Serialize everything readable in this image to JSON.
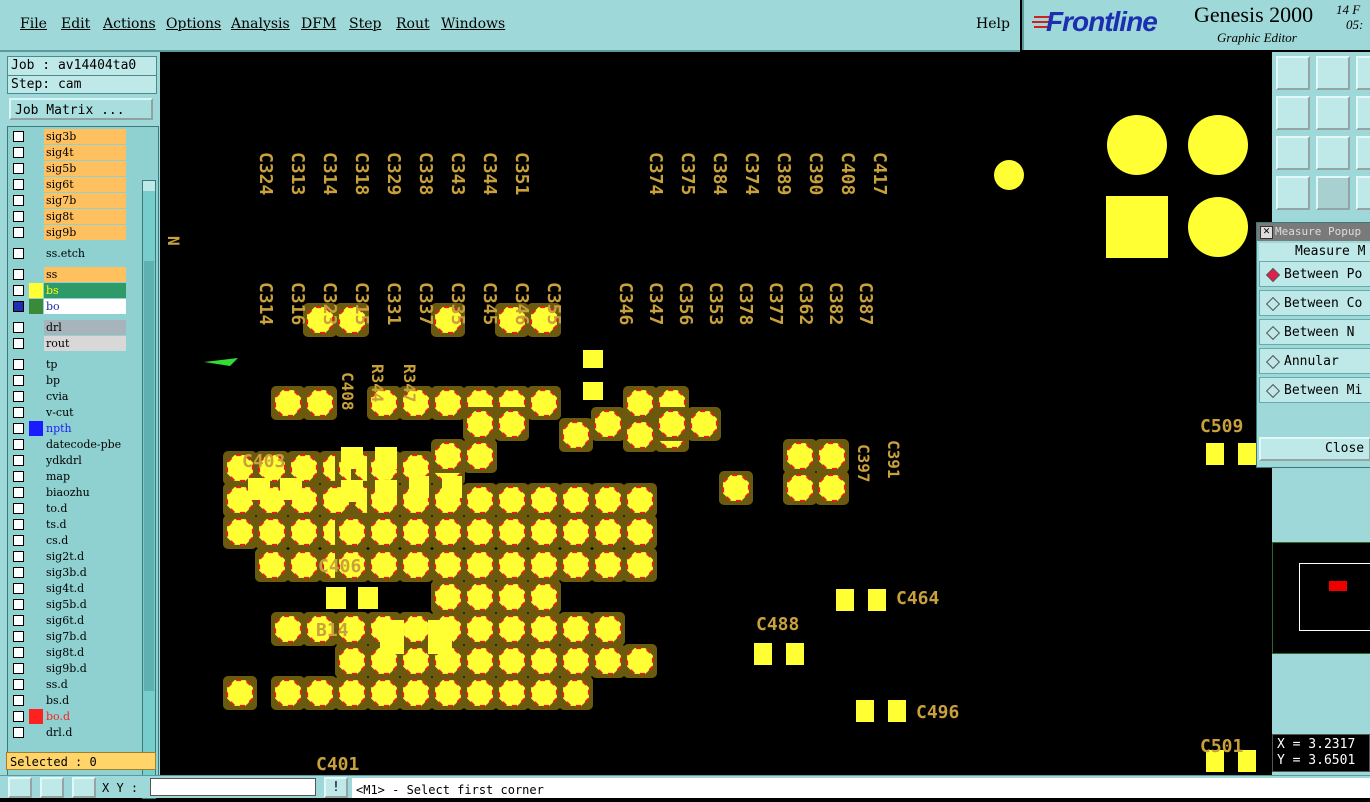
{
  "menu": {
    "items": [
      "File",
      "Edit",
      "Actions",
      "Options",
      "Analysis",
      "DFM",
      "Step",
      "Rout",
      "Windows"
    ],
    "help": "Help"
  },
  "brand": {
    "logo": "Frontline",
    "product": "Genesis 2000",
    "subtitle": "Graphic Editor",
    "date_fragment": "14 F",
    "time_fragment": "05:"
  },
  "job": {
    "job_line": "Job : av14404ta0",
    "step_line": "Step: cam",
    "matrix_button": "Job Matrix ..."
  },
  "layers": [
    {
      "name": "sig3b",
      "bg": "#ffc060"
    },
    {
      "name": "sig4t",
      "bg": "#ffc060"
    },
    {
      "name": "sig5b",
      "bg": "#ffc060"
    },
    {
      "name": "sig6t",
      "bg": "#ffc060"
    },
    {
      "name": "sig7b",
      "bg": "#ffc060"
    },
    {
      "name": "sig8t",
      "bg": "#ffc060"
    },
    {
      "name": "sig9b",
      "bg": "#ffc060"
    },
    {
      "name": "ss.etch",
      "bg": "#8fd0d0"
    },
    {
      "name": "ss",
      "bg": "#ffc060"
    },
    {
      "name": "bs",
      "bg": "#2e9a6a",
      "color": "#ffff00"
    },
    {
      "name": "bo",
      "bg": "#ffffff",
      "color": "#1c2a9a"
    },
    {
      "name": "drl",
      "bg": "#a8b4bc"
    },
    {
      "name": "rout",
      "bg": "#d8d8d8"
    },
    {
      "name": "tp",
      "bg": "#8fd0d0"
    },
    {
      "name": "bp",
      "bg": "#8fd0d0"
    },
    {
      "name": "cvia",
      "bg": "#8fd0d0"
    },
    {
      "name": "v-cut",
      "bg": "#8fd0d0"
    },
    {
      "name": "npth",
      "bg": "#8fd0d0",
      "color": "#1b1bff"
    },
    {
      "name": "datecode-pbe",
      "bg": "#8fd0d0"
    },
    {
      "name": "ydkdrl",
      "bg": "#8fd0d0"
    },
    {
      "name": "map",
      "bg": "#8fd0d0"
    },
    {
      "name": "biaozhu",
      "bg": "#8fd0d0"
    },
    {
      "name": "to.d",
      "bg": "#8fd0d0"
    },
    {
      "name": "ts.d",
      "bg": "#8fd0d0"
    },
    {
      "name": "cs.d",
      "bg": "#8fd0d0"
    },
    {
      "name": "sig2t.d",
      "bg": "#8fd0d0"
    },
    {
      "name": "sig3b.d",
      "bg": "#8fd0d0"
    },
    {
      "name": "sig4t.d",
      "bg": "#8fd0d0"
    },
    {
      "name": "sig5b.d",
      "bg": "#8fd0d0"
    },
    {
      "name": "sig6t.d",
      "bg": "#8fd0d0"
    },
    {
      "name": "sig7b.d",
      "bg": "#8fd0d0"
    },
    {
      "name": "sig8t.d",
      "bg": "#8fd0d0"
    },
    {
      "name": "sig9b.d",
      "bg": "#8fd0d0"
    },
    {
      "name": "ss.d",
      "bg": "#8fd0d0"
    },
    {
      "name": "bs.d",
      "bg": "#8fd0d0"
    },
    {
      "name": "bo.d",
      "bg": "#8fd0d0",
      "color": "#ff2020"
    },
    {
      "name": "drl.d",
      "bg": "#8fd0d0"
    }
  ],
  "selected": "Selected : 0",
  "measure_popup": {
    "title": "Measure Popup",
    "header": "Measure M",
    "options": [
      "Between Po",
      "Between Co",
      "Between N",
      "Annular",
      "Between Mi"
    ],
    "close": "Close"
  },
  "coords": {
    "x": "X = 3.2317",
    "y": "Y = 3.6501"
  },
  "status": {
    "xy_label": "X Y :",
    "message": "<M1> - Select first corner"
  },
  "canvas": {
    "refdes_top_left": [
      "C324",
      "C313",
      "C314",
      "C318",
      "C329",
      "C338",
      "C343",
      "C344",
      "C351"
    ],
    "refdes_top_right": [
      "C374",
      "C375",
      "C384",
      "C374",
      "C389",
      "C390",
      "C408",
      "C417"
    ],
    "refdes_mid_left": [
      "C314",
      "C316",
      "C323",
      "C315",
      "C331",
      "C337",
      "C335",
      "C345",
      "C346",
      "C355"
    ],
    "refdes_mid_right": [
      "C346",
      "C347",
      "C356",
      "C353",
      "C378",
      "C377",
      "C362",
      "C382",
      "C387"
    ],
    "labels": [
      "C408",
      "R344",
      "R347",
      "C403",
      "C406",
      "B14",
      "C464",
      "C488",
      "C496",
      "C501",
      "C509",
      "C397",
      "C391",
      "C401"
    ]
  },
  "colors": {
    "pad": "#ffff33",
    "pad_edge": "#e02020",
    "mask": "#9c7a10",
    "silk": "#c8a03c",
    "panel": "#9fd8d8"
  }
}
